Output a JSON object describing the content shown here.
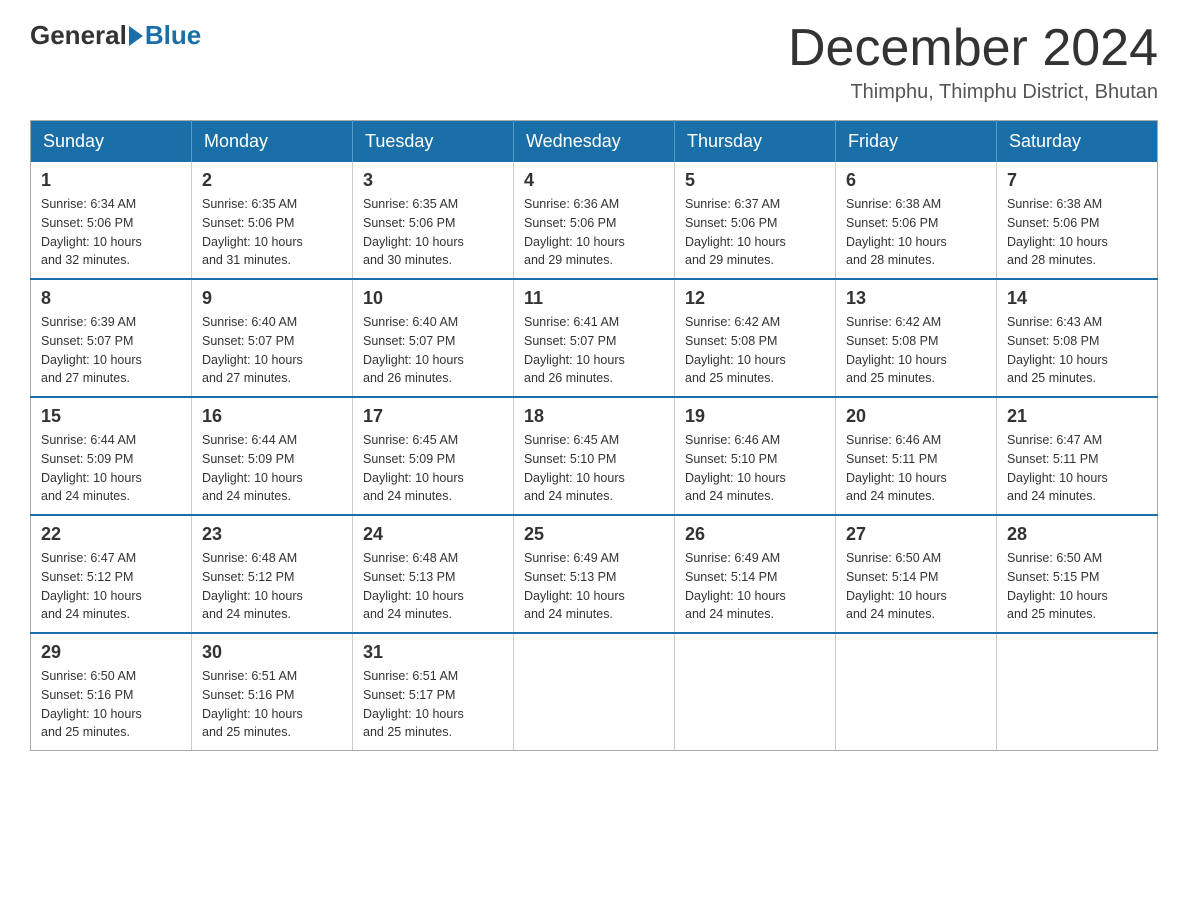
{
  "header": {
    "logo": {
      "part1": "General",
      "part2": "Blue"
    },
    "title": "December 2024",
    "location": "Thimphu, Thimphu District, Bhutan"
  },
  "calendar": {
    "headers": [
      "Sunday",
      "Monday",
      "Tuesday",
      "Wednesday",
      "Thursday",
      "Friday",
      "Saturday"
    ],
    "weeks": [
      [
        {
          "day": "1",
          "sunrise": "6:34 AM",
          "sunset": "5:06 PM",
          "daylight": "10 hours and 32 minutes."
        },
        {
          "day": "2",
          "sunrise": "6:35 AM",
          "sunset": "5:06 PM",
          "daylight": "10 hours and 31 minutes."
        },
        {
          "day": "3",
          "sunrise": "6:35 AM",
          "sunset": "5:06 PM",
          "daylight": "10 hours and 30 minutes."
        },
        {
          "day": "4",
          "sunrise": "6:36 AM",
          "sunset": "5:06 PM",
          "daylight": "10 hours and 29 minutes."
        },
        {
          "day": "5",
          "sunrise": "6:37 AM",
          "sunset": "5:06 PM",
          "daylight": "10 hours and 29 minutes."
        },
        {
          "day": "6",
          "sunrise": "6:38 AM",
          "sunset": "5:06 PM",
          "daylight": "10 hours and 28 minutes."
        },
        {
          "day": "7",
          "sunrise": "6:38 AM",
          "sunset": "5:06 PM",
          "daylight": "10 hours and 28 minutes."
        }
      ],
      [
        {
          "day": "8",
          "sunrise": "6:39 AM",
          "sunset": "5:07 PM",
          "daylight": "10 hours and 27 minutes."
        },
        {
          "day": "9",
          "sunrise": "6:40 AM",
          "sunset": "5:07 PM",
          "daylight": "10 hours and 27 minutes."
        },
        {
          "day": "10",
          "sunrise": "6:40 AM",
          "sunset": "5:07 PM",
          "daylight": "10 hours and 26 minutes."
        },
        {
          "day": "11",
          "sunrise": "6:41 AM",
          "sunset": "5:07 PM",
          "daylight": "10 hours and 26 minutes."
        },
        {
          "day": "12",
          "sunrise": "6:42 AM",
          "sunset": "5:08 PM",
          "daylight": "10 hours and 25 minutes."
        },
        {
          "day": "13",
          "sunrise": "6:42 AM",
          "sunset": "5:08 PM",
          "daylight": "10 hours and 25 minutes."
        },
        {
          "day": "14",
          "sunrise": "6:43 AM",
          "sunset": "5:08 PM",
          "daylight": "10 hours and 25 minutes."
        }
      ],
      [
        {
          "day": "15",
          "sunrise": "6:44 AM",
          "sunset": "5:09 PM",
          "daylight": "10 hours and 24 minutes."
        },
        {
          "day": "16",
          "sunrise": "6:44 AM",
          "sunset": "5:09 PM",
          "daylight": "10 hours and 24 minutes."
        },
        {
          "day": "17",
          "sunrise": "6:45 AM",
          "sunset": "5:09 PM",
          "daylight": "10 hours and 24 minutes."
        },
        {
          "day": "18",
          "sunrise": "6:45 AM",
          "sunset": "5:10 PM",
          "daylight": "10 hours and 24 minutes."
        },
        {
          "day": "19",
          "sunrise": "6:46 AM",
          "sunset": "5:10 PM",
          "daylight": "10 hours and 24 minutes."
        },
        {
          "day": "20",
          "sunrise": "6:46 AM",
          "sunset": "5:11 PM",
          "daylight": "10 hours and 24 minutes."
        },
        {
          "day": "21",
          "sunrise": "6:47 AM",
          "sunset": "5:11 PM",
          "daylight": "10 hours and 24 minutes."
        }
      ],
      [
        {
          "day": "22",
          "sunrise": "6:47 AM",
          "sunset": "5:12 PM",
          "daylight": "10 hours and 24 minutes."
        },
        {
          "day": "23",
          "sunrise": "6:48 AM",
          "sunset": "5:12 PM",
          "daylight": "10 hours and 24 minutes."
        },
        {
          "day": "24",
          "sunrise": "6:48 AM",
          "sunset": "5:13 PM",
          "daylight": "10 hours and 24 minutes."
        },
        {
          "day": "25",
          "sunrise": "6:49 AM",
          "sunset": "5:13 PM",
          "daylight": "10 hours and 24 minutes."
        },
        {
          "day": "26",
          "sunrise": "6:49 AM",
          "sunset": "5:14 PM",
          "daylight": "10 hours and 24 minutes."
        },
        {
          "day": "27",
          "sunrise": "6:50 AM",
          "sunset": "5:14 PM",
          "daylight": "10 hours and 24 minutes."
        },
        {
          "day": "28",
          "sunrise": "6:50 AM",
          "sunset": "5:15 PM",
          "daylight": "10 hours and 25 minutes."
        }
      ],
      [
        {
          "day": "29",
          "sunrise": "6:50 AM",
          "sunset": "5:16 PM",
          "daylight": "10 hours and 25 minutes."
        },
        {
          "day": "30",
          "sunrise": "6:51 AM",
          "sunset": "5:16 PM",
          "daylight": "10 hours and 25 minutes."
        },
        {
          "day": "31",
          "sunrise": "6:51 AM",
          "sunset": "5:17 PM",
          "daylight": "10 hours and 25 minutes."
        },
        null,
        null,
        null,
        null
      ]
    ]
  }
}
